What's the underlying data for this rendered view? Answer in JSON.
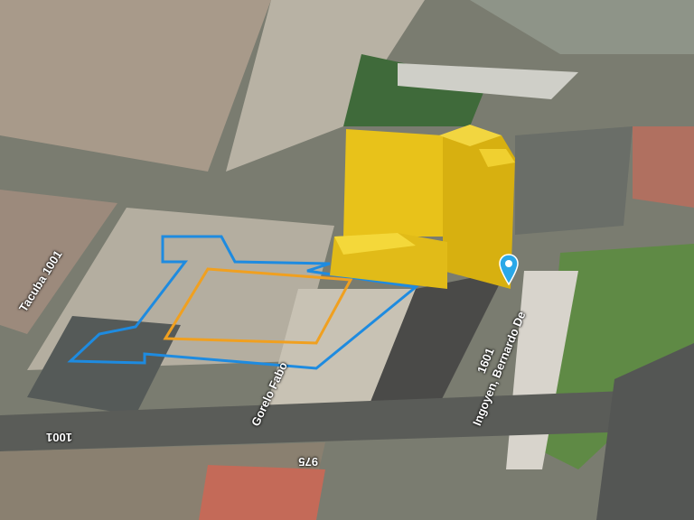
{
  "map": {
    "type": "3d-satellite",
    "colors": {
      "building_3d": "#e8c21a",
      "outline_blue": "#1e8be0",
      "outline_orange": "#f0a020",
      "pin": "#2aa8e8"
    },
    "street_labels": [
      {
        "id": "tacuba",
        "text": "Tacuba 1001"
      },
      {
        "id": "gorelo",
        "text": "Gorelo Fabo"
      },
      {
        "id": "bernardo",
        "text": "Ingoyen, Bernardo De"
      },
      {
        "id": "num1601",
        "text": "1601"
      },
      {
        "id": "num975",
        "text": "975"
      },
      {
        "id": "num1001",
        "text": "1001"
      }
    ],
    "pin_icon": "location-pin-icon"
  }
}
